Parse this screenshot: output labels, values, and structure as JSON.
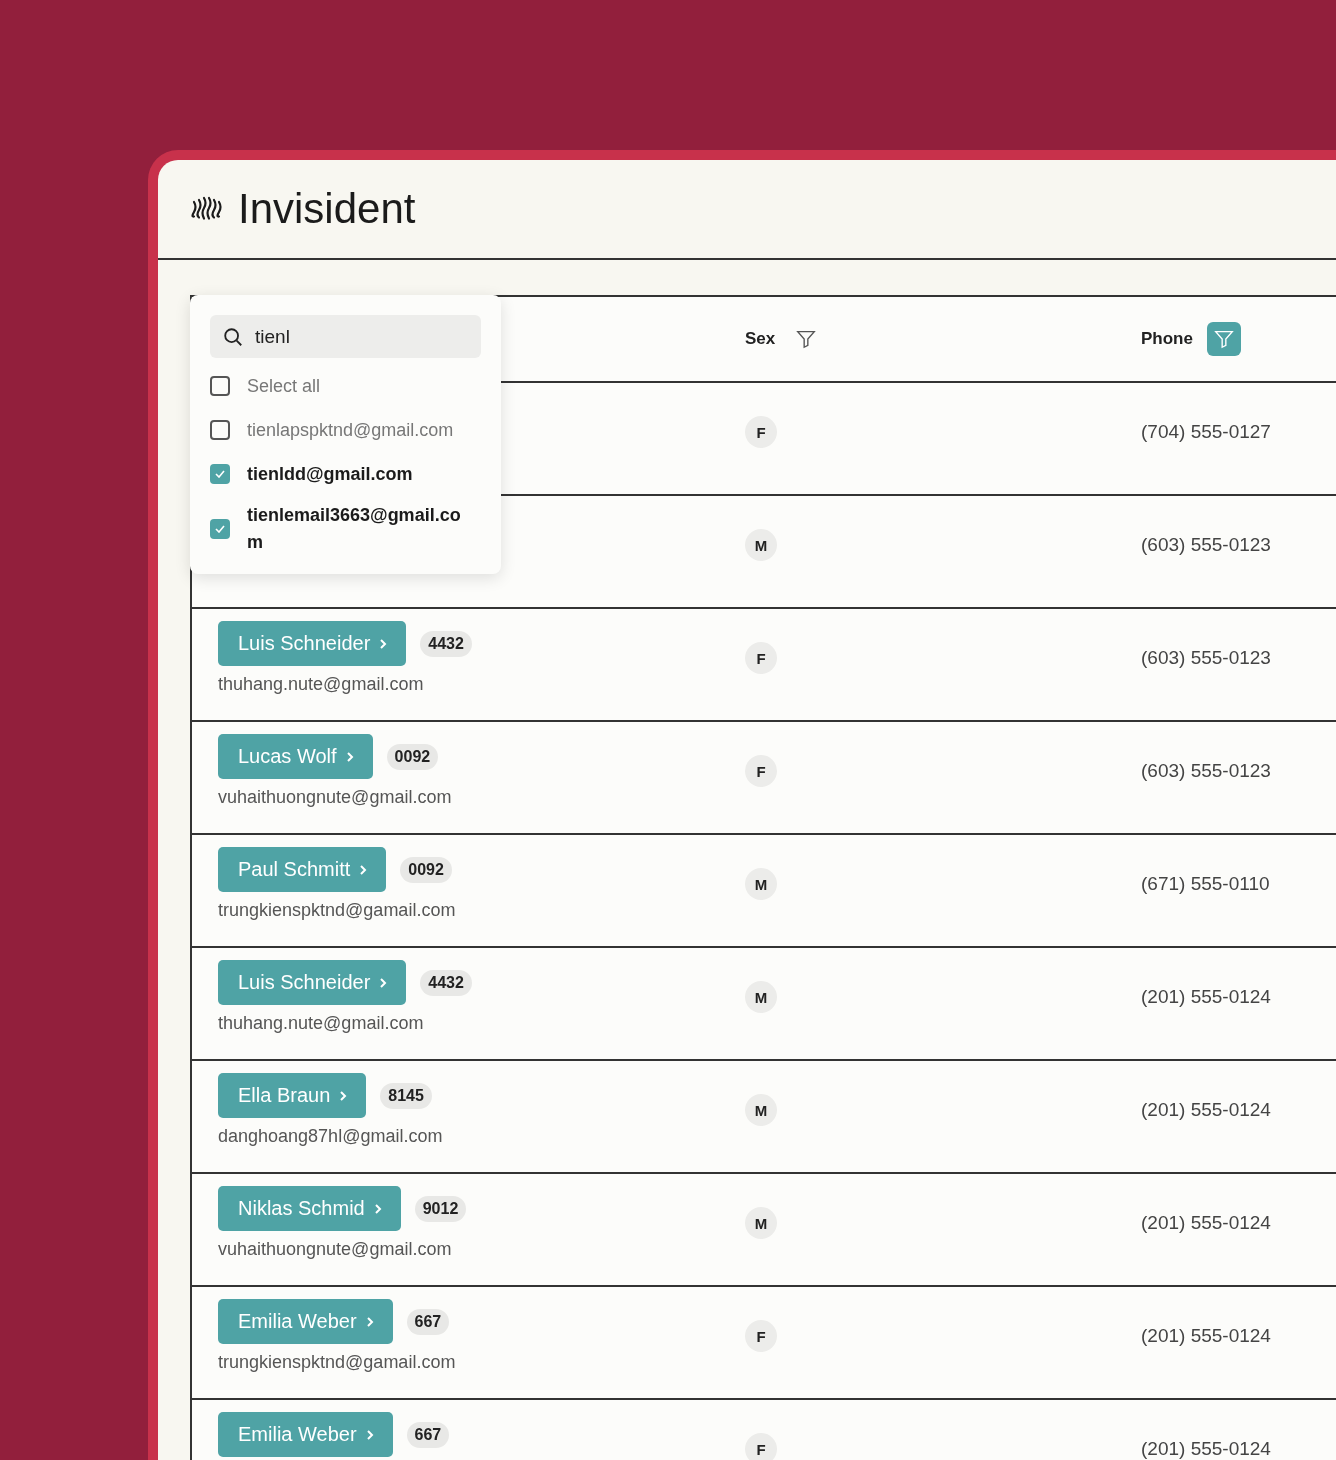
{
  "app": {
    "title": "Invisident"
  },
  "table": {
    "columns": [
      {
        "label": "Sex",
        "filter_active": false
      },
      {
        "label": "Phone",
        "filter_active": true
      }
    ],
    "rows": [
      {
        "sex": "F",
        "phone": "(704) 555-0127"
      },
      {
        "sex": "M",
        "phone": "(603) 555-0123"
      },
      {
        "name": "Luis Schneider",
        "code": "4432",
        "email": "thuhang.nute@gmail.com",
        "sex": "F",
        "phone": "(603) 555-0123"
      },
      {
        "name": "Lucas Wolf",
        "code": "0092",
        "email": "vuhaithuongnute@gmail.com",
        "sex": "F",
        "phone": "(603) 555-0123"
      },
      {
        "name": "Paul Schmitt",
        "code": "0092",
        "email": "trungkienspktnd@gamail.com",
        "sex": "M",
        "phone": "(671) 555-0110"
      },
      {
        "name": "Luis Schneider",
        "code": "4432",
        "email": "thuhang.nute@gmail.com",
        "sex": "M",
        "phone": "(201) 555-0124"
      },
      {
        "name": "Ella Braun",
        "code": "8145",
        "email": "danghoang87hl@gmail.com",
        "sex": "M",
        "phone": "(201) 555-0124"
      },
      {
        "name": "Niklas Schmid",
        "code": "9012",
        "email": "vuhaithuongnute@gmail.com",
        "sex": "M",
        "phone": "(201) 555-0124"
      },
      {
        "name": "Emilia Weber",
        "code": "667",
        "email": "trungkienspktnd@gamail.com",
        "sex": "F",
        "phone": "(201) 555-0124"
      },
      {
        "name": "Emilia Weber",
        "code": "667",
        "sex": "F",
        "phone": "(201) 555-0124"
      }
    ]
  },
  "filter_popup": {
    "search": {
      "value": "tienl"
    },
    "options": [
      {
        "label": "Select all",
        "checked": false
      },
      {
        "label": "tienlapspktnd@gmail.com",
        "checked": false
      },
      {
        "label": "tienldd@gmail.com",
        "checked": true
      },
      {
        "label": "tienlemail3663@gmail.com",
        "checked": true
      }
    ]
  }
}
